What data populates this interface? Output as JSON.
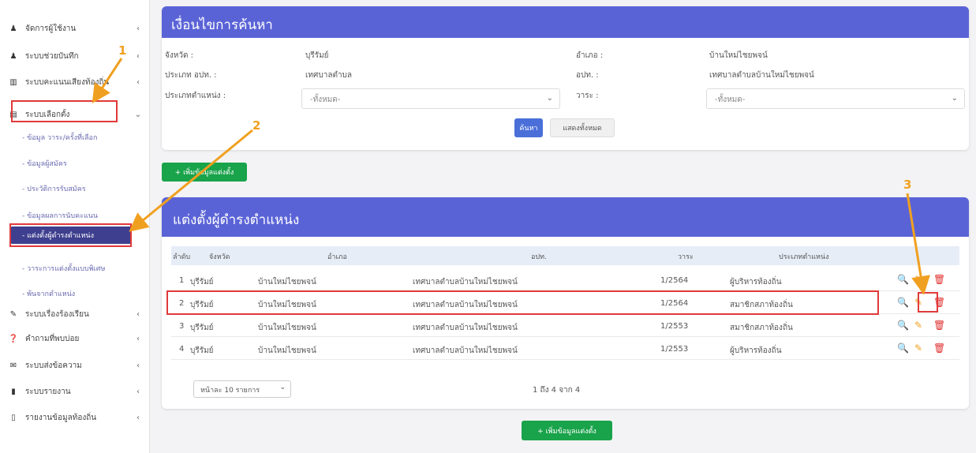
{
  "sidebar": {
    "items": [
      {
        "icon": "user-icon",
        "glyph": "♟",
        "label": "จัดการผู้ใช้งาน",
        "chevron": "‹"
      },
      {
        "icon": "user-plus-icon",
        "glyph": "♟",
        "label": "ระบบช่วยบันทึก",
        "chevron": "‹"
      },
      {
        "icon": "building-icon",
        "glyph": "▥",
        "label": "ระบบคะแนนเสียงท้องถิ่น",
        "chevron": "‹"
      },
      {
        "icon": "list-icon",
        "glyph": "▤",
        "label": "ระบบเลือกตั้ง",
        "chevron": "⌄"
      },
      {
        "icon": "megaphone-icon",
        "glyph": "✎",
        "label": "ระบบเรื่องร้องเรียน",
        "chevron": "‹"
      },
      {
        "icon": "question-icon",
        "glyph": "❓",
        "label": "คำถามที่พบบ่อย",
        "chevron": "‹"
      },
      {
        "icon": "envelope-icon",
        "glyph": "✉",
        "label": "ระบบส่งข้อความ",
        "chevron": "‹"
      },
      {
        "icon": "book-icon",
        "glyph": "▮",
        "label": "ระบบรายงาน",
        "chevron": "‹"
      },
      {
        "icon": "file-icon",
        "glyph": "▯",
        "label": "รายงานข้อมูลท้องถิ่น",
        "chevron": "‹"
      }
    ],
    "subitems": [
      "- ข้อมูล วาระ/ครั้งที่เลือก",
      "- ข้อมูลผู้สมัคร",
      "- ประวัติการรับสมัคร",
      "- ข้อมูลผลการนับคะแนน",
      "- แต่งตั้งผู้ดำรงตำแหน่ง",
      "- วาระการแต่งตั้งแบบพิเศษ",
      "- พ้นจากตำแหน่ง"
    ]
  },
  "search": {
    "title": "เงื่อนไขการค้นหา",
    "province_label": "จังหวัด :",
    "province_value": "บุรีรัมย์",
    "district_label": "อำเภอ :",
    "district_value": "บ้านใหม่ไชยพจน์",
    "org_type_label": "ประเภท อปท. :",
    "org_type_value": "เทศบาลตำบล",
    "org_label": "อปท. :",
    "org_value": "เทศบาลตำบลบ้านใหม่ไชยพจน์",
    "position_label": "ประเภทตำแหน่ง :",
    "position_placeholder": "-ทั้งหมด-",
    "term_label": "วาระ :",
    "term_placeholder": "-ทั้งหมด-",
    "search_button": "ค้นหา",
    "show_all_button": "แสดงทั้งหมด"
  },
  "add_button_top": "+ เพิ่มข้อมูลแต่งตั้ง",
  "add_button_bottom": "+ เพิ่มข้อมูลแต่งตั้ง",
  "table": {
    "title": "แต่งตั้งผู้ดำรงตำแหน่ง",
    "headers": [
      "ลำดับ",
      "จังหวัด",
      "อำเภอ",
      "อปท.",
      "วาระ",
      "ประเภทตำแหน่ง"
    ],
    "rows": [
      [
        "1",
        "บุรีรัมย์",
        "บ้านใหม่ไชยพจน์",
        "เทศบาลตำบลบ้านใหม่ไชยพจน์",
        "1/2564",
        "ผู้บริหารท้องถิ่น"
      ],
      [
        "2",
        "บุรีรัมย์",
        "บ้านใหม่ไชยพจน์",
        "เทศบาลตำบลบ้านใหม่ไชยพจน์",
        "1/2564",
        "สมาชิกสภาท้องถิ่น"
      ],
      [
        "3",
        "บุรีรัมย์",
        "บ้านใหม่ไชยพจน์",
        "เทศบาลตำบลบ้านใหม่ไชยพจน์",
        "1/2553",
        "สมาชิกสภาท้องถิ่น"
      ],
      [
        "4",
        "บุรีรัมย์",
        "บ้านใหม่ไชยพจน์",
        "เทศบาลตำบลบ้านใหม่ไชยพจน์",
        "1/2553",
        "ผู้บริหารท้องถิ่น"
      ]
    ],
    "actions": {
      "view": "🔍",
      "edit": "✎",
      "delete": "🗑"
    },
    "page_size": "หน้าละ 10 รายการ",
    "page_caret": "⌄",
    "count_text": "1 ถึง 4 จาก 4"
  },
  "annotations": {
    "one": "1",
    "two": "2",
    "three": "3"
  },
  "colors": {
    "header": "#5a63d6",
    "active_nav": "#3f3f8f",
    "highlight": "#e03a3a",
    "arrow": "#f0a020",
    "green": "#19a34a"
  }
}
